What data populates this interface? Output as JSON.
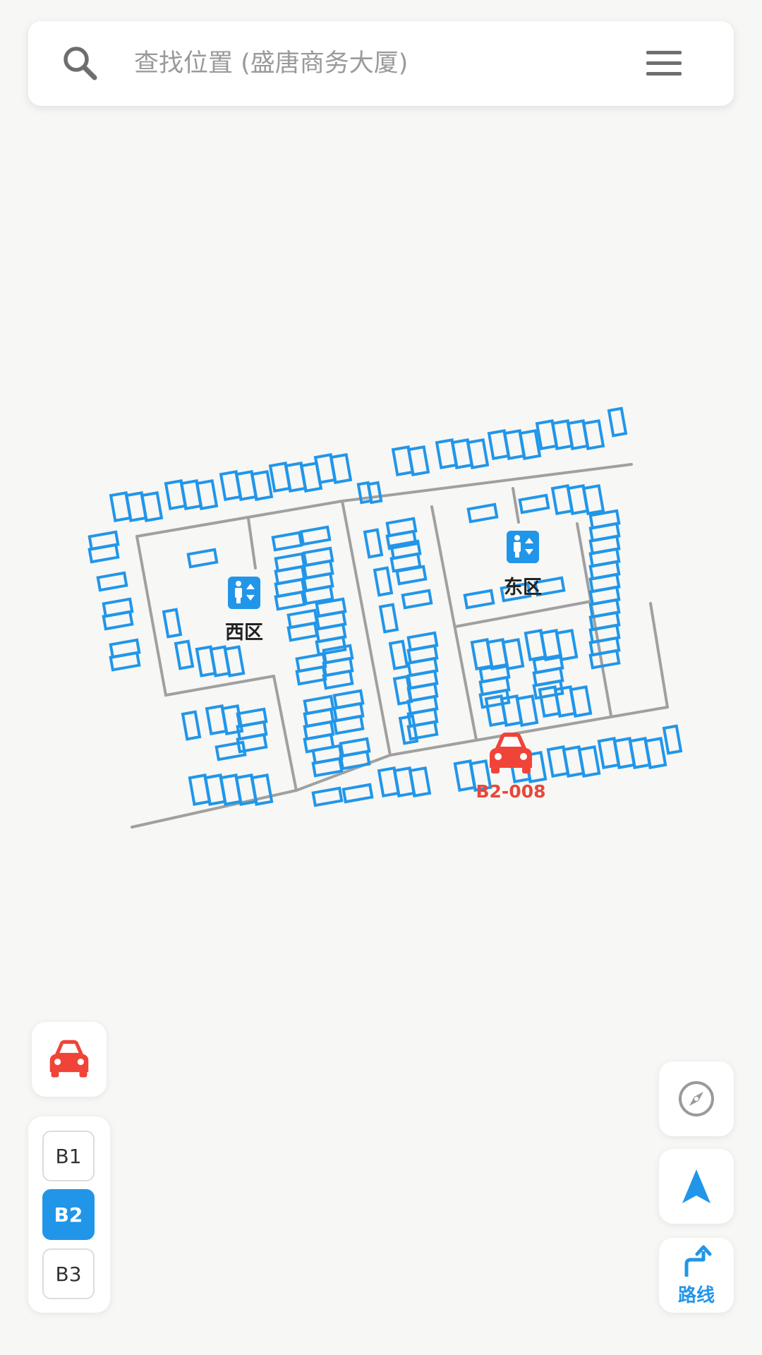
{
  "search": {
    "placeholder": "查找位置 (盛唐商务大厦)"
  },
  "icons": {
    "search": "search-icon",
    "menu": "hamburger-menu-icon",
    "restroom": "restroom-icon",
    "car": "car-icon",
    "compass": "compass-icon",
    "navigate": "navigation-arrow-icon",
    "route": "route-turn-icon"
  },
  "map": {
    "zones": [
      {
        "label": "西区"
      },
      {
        "label": "东区"
      }
    ],
    "parked_car": {
      "space_label": "B2-008"
    }
  },
  "floors": {
    "items": [
      {
        "label": "B1",
        "active": false
      },
      {
        "label": "B2",
        "active": true
      },
      {
        "label": "B3",
        "active": false
      }
    ]
  },
  "route": {
    "label": "路线"
  },
  "colors": {
    "accent": "#2196e9",
    "car": "#f04438",
    "road": "#a0a0a0",
    "background": "#f7f7f5"
  }
}
